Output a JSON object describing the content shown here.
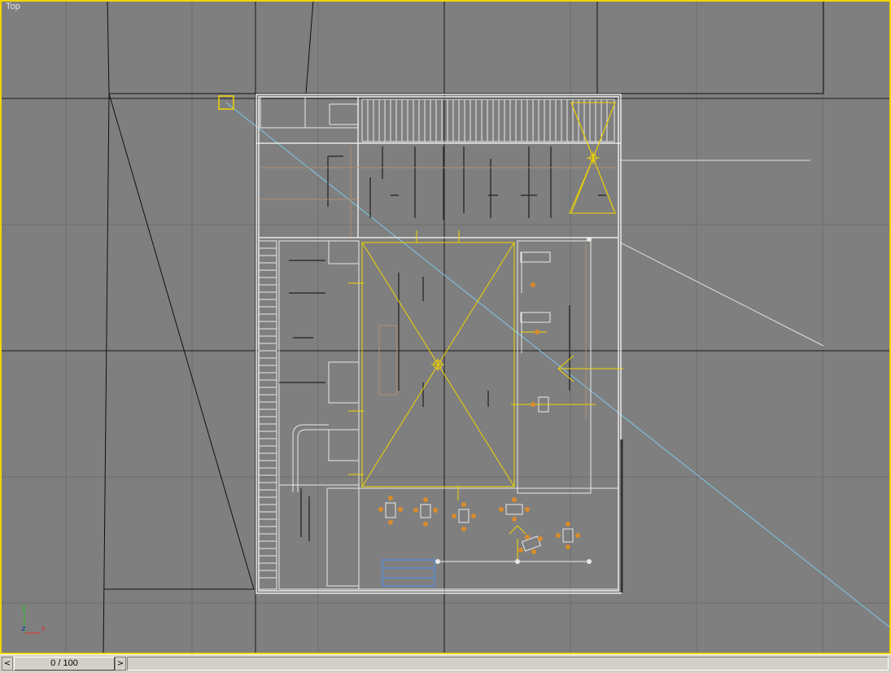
{
  "viewport": {
    "label": "Top",
    "axis": {
      "x": "x",
      "y": "y",
      "z": "z"
    },
    "border_color": "#f2d400",
    "background_color": "#7f7f7f"
  },
  "timeslider": {
    "value": "0 / 100",
    "left_arrow": "<",
    "right_arrow": ">"
  },
  "colors": {
    "grid": "#6c6c6c",
    "grid_major": "#1a1a1a",
    "wire": "#e8e8e8",
    "light": "#f2d400",
    "camera_line": "#7ec8e8",
    "furniture": "#d98b2b",
    "glass": "#5a8cd0"
  }
}
